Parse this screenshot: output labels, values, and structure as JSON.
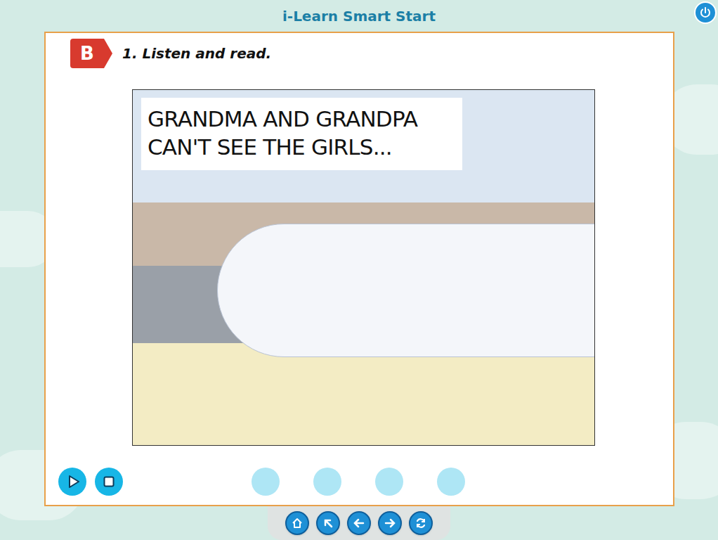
{
  "app": {
    "title": "i-Learn Smart Start"
  },
  "section": {
    "badge": "B",
    "instruction": "1. Listen and read."
  },
  "story": {
    "caption": "GRANDMA AND GRANDPA CAN'T SEE THE GIRLS..."
  },
  "pages": [
    {
      "selected": false
    },
    {
      "selected": false
    },
    {
      "selected": false
    },
    {
      "selected": false
    }
  ]
}
